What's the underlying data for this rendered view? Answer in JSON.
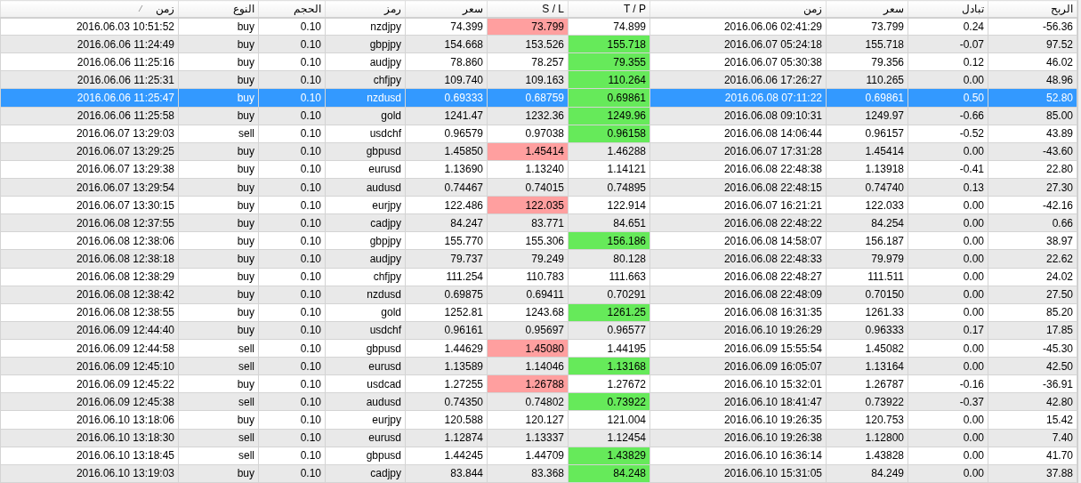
{
  "table": {
    "columns": [
      "زمن",
      "النوع",
      "الحجم",
      "رمز",
      "سعر",
      "S / L",
      "T / P",
      "زمن",
      "سعر",
      "تبادل",
      "الربح"
    ],
    "rows": [
      {
        "cells": [
          "2016.06.03 10:51:52",
          "buy",
          "0.10",
          "nzdjpy",
          "74.399",
          "73.799",
          "74.899",
          "2016.06.06 02:41:29",
          "73.799",
          "0.24",
          "-56.36"
        ],
        "sl_hit": true,
        "tp_hit": false,
        "selected": false
      },
      {
        "cells": [
          "2016.06.06 11:24:49",
          "buy",
          "0.10",
          "gbpjpy",
          "154.668",
          "153.526",
          "155.718",
          "2016.06.07 05:24:18",
          "155.718",
          "-0.07",
          "97.52"
        ],
        "sl_hit": false,
        "tp_hit": true,
        "selected": false
      },
      {
        "cells": [
          "2016.06.06 11:25:16",
          "buy",
          "0.10",
          "audjpy",
          "78.860",
          "78.257",
          "79.355",
          "2016.06.07 05:30:38",
          "79.356",
          "0.12",
          "46.02"
        ],
        "sl_hit": false,
        "tp_hit": true,
        "selected": false
      },
      {
        "cells": [
          "2016.06.06 11:25:31",
          "buy",
          "0.10",
          "chfjpy",
          "109.740",
          "109.163",
          "110.264",
          "2016.06.06 17:26:27",
          "110.265",
          "0.00",
          "48.96"
        ],
        "sl_hit": false,
        "tp_hit": true,
        "selected": false
      },
      {
        "cells": [
          "2016.06.06 11:25:47",
          "buy",
          "0.10",
          "nzdusd",
          "0.69333",
          "0.68759",
          "0.69861",
          "2016.06.08 07:11:22",
          "0.69861",
          "0.50",
          "52.80"
        ],
        "sl_hit": false,
        "tp_hit": true,
        "selected": true
      },
      {
        "cells": [
          "2016.06.06 11:25:58",
          "buy",
          "0.10",
          "gold",
          "1241.47",
          "1232.36",
          "1249.96",
          "2016.06.08 09:10:31",
          "1249.97",
          "-0.66",
          "85.00"
        ],
        "sl_hit": false,
        "tp_hit": true,
        "selected": false
      },
      {
        "cells": [
          "2016.06.07 13:29:03",
          "sell",
          "0.10",
          "usdchf",
          "0.96579",
          "0.97038",
          "0.96158",
          "2016.06.08 14:06:44",
          "0.96157",
          "-0.52",
          "43.89"
        ],
        "sl_hit": false,
        "tp_hit": true,
        "selected": false
      },
      {
        "cells": [
          "2016.06.07 13:29:25",
          "buy",
          "0.10",
          "gbpusd",
          "1.45850",
          "1.45414",
          "1.46288",
          "2016.06.07 17:31:28",
          "1.45414",
          "0.00",
          "-43.60"
        ],
        "sl_hit": true,
        "tp_hit": false,
        "selected": false
      },
      {
        "cells": [
          "2016.06.07 13:29:38",
          "buy",
          "0.10",
          "eurusd",
          "1.13690",
          "1.13240",
          "1.14121",
          "2016.06.08 22:48:38",
          "1.13918",
          "-0.41",
          "22.80"
        ],
        "sl_hit": false,
        "tp_hit": false,
        "selected": false
      },
      {
        "cells": [
          "2016.06.07 13:29:54",
          "buy",
          "0.10",
          "audusd",
          "0.74467",
          "0.74015",
          "0.74895",
          "2016.06.08 22:48:15",
          "0.74740",
          "0.13",
          "27.30"
        ],
        "sl_hit": false,
        "tp_hit": false,
        "selected": false
      },
      {
        "cells": [
          "2016.06.07 13:30:15",
          "buy",
          "0.10",
          "eurjpy",
          "122.486",
          "122.035",
          "122.914",
          "2016.06.07 16:21:21",
          "122.033",
          "0.00",
          "-42.16"
        ],
        "sl_hit": true,
        "tp_hit": false,
        "selected": false
      },
      {
        "cells": [
          "2016.06.08 12:37:55",
          "buy",
          "0.10",
          "cadjpy",
          "84.247",
          "83.771",
          "84.651",
          "2016.06.08 22:48:22",
          "84.254",
          "0.00",
          "0.66"
        ],
        "sl_hit": false,
        "tp_hit": false,
        "selected": false
      },
      {
        "cells": [
          "2016.06.08 12:38:06",
          "buy",
          "0.10",
          "gbpjpy",
          "155.770",
          "155.306",
          "156.186",
          "2016.06.08 14:58:07",
          "156.187",
          "0.00",
          "38.97"
        ],
        "sl_hit": false,
        "tp_hit": true,
        "selected": false
      },
      {
        "cells": [
          "2016.06.08 12:38:18",
          "buy",
          "0.10",
          "audjpy",
          "79.737",
          "79.249",
          "80.128",
          "2016.06.08 22:48:33",
          "79.979",
          "0.00",
          "22.62"
        ],
        "sl_hit": false,
        "tp_hit": false,
        "selected": false
      },
      {
        "cells": [
          "2016.06.08 12:38:29",
          "buy",
          "0.10",
          "chfjpy",
          "111.254",
          "110.783",
          "111.663",
          "2016.06.08 22:48:27",
          "111.511",
          "0.00",
          "24.02"
        ],
        "sl_hit": false,
        "tp_hit": false,
        "selected": false
      },
      {
        "cells": [
          "2016.06.08 12:38:42",
          "buy",
          "0.10",
          "nzdusd",
          "0.69875",
          "0.69411",
          "0.70291",
          "2016.06.08 22:48:09",
          "0.70150",
          "0.00",
          "27.50"
        ],
        "sl_hit": false,
        "tp_hit": false,
        "selected": false
      },
      {
        "cells": [
          "2016.06.08 12:38:55",
          "buy",
          "0.10",
          "gold",
          "1252.81",
          "1243.68",
          "1261.25",
          "2016.06.08 16:31:35",
          "1261.33",
          "0.00",
          "85.20"
        ],
        "sl_hit": false,
        "tp_hit": true,
        "selected": false
      },
      {
        "cells": [
          "2016.06.09 12:44:40",
          "buy",
          "0.10",
          "usdchf",
          "0.96161",
          "0.95697",
          "0.96577",
          "2016.06.10 19:26:29",
          "0.96333",
          "0.17",
          "17.85"
        ],
        "sl_hit": false,
        "tp_hit": false,
        "selected": false
      },
      {
        "cells": [
          "2016.06.09 12:44:58",
          "sell",
          "0.10",
          "gbpusd",
          "1.44629",
          "1.45080",
          "1.44195",
          "2016.06.09 15:55:54",
          "1.45082",
          "0.00",
          "-45.30"
        ],
        "sl_hit": true,
        "tp_hit": false,
        "selected": false
      },
      {
        "cells": [
          "2016.06.09 12:45:10",
          "sell",
          "0.10",
          "eurusd",
          "1.13589",
          "1.14046",
          "1.13168",
          "2016.06.09 16:05:07",
          "1.13164",
          "0.00",
          "42.50"
        ],
        "sl_hit": false,
        "tp_hit": true,
        "selected": false
      },
      {
        "cells": [
          "2016.06.09 12:45:22",
          "buy",
          "0.10",
          "usdcad",
          "1.27255",
          "1.26788",
          "1.27672",
          "2016.06.10 15:32:01",
          "1.26787",
          "-0.16",
          "-36.91"
        ],
        "sl_hit": true,
        "tp_hit": false,
        "selected": false
      },
      {
        "cells": [
          "2016.06.09 12:45:38",
          "sell",
          "0.10",
          "audusd",
          "0.74350",
          "0.74802",
          "0.73922",
          "2016.06.10 18:41:47",
          "0.73922",
          "-0.37",
          "42.80"
        ],
        "sl_hit": false,
        "tp_hit": true,
        "selected": false
      },
      {
        "cells": [
          "2016.06.10 13:18:06",
          "buy",
          "0.10",
          "eurjpy",
          "120.588",
          "120.127",
          "121.004",
          "2016.06.10 19:26:35",
          "120.753",
          "0.00",
          "15.42"
        ],
        "sl_hit": false,
        "tp_hit": false,
        "selected": false
      },
      {
        "cells": [
          "2016.06.10 13:18:30",
          "sell",
          "0.10",
          "eurusd",
          "1.12874",
          "1.13337",
          "1.12454",
          "2016.06.10 19:26:38",
          "1.12800",
          "0.00",
          "7.40"
        ],
        "sl_hit": false,
        "tp_hit": false,
        "selected": false
      },
      {
        "cells": [
          "2016.06.10 13:18:45",
          "sell",
          "0.10",
          "gbpusd",
          "1.44245",
          "1.44709",
          "1.43829",
          "2016.06.10 16:36:14",
          "1.43828",
          "0.00",
          "41.70"
        ],
        "sl_hit": false,
        "tp_hit": true,
        "selected": false
      },
      {
        "cells": [
          "2016.06.10 13:19:03",
          "buy",
          "0.10",
          "cadjpy",
          "83.844",
          "83.368",
          "84.248",
          "2016.06.10 15:31:05",
          "84.249",
          "0.00",
          "37.88"
        ],
        "sl_hit": false,
        "tp_hit": true,
        "selected": false
      }
    ]
  }
}
